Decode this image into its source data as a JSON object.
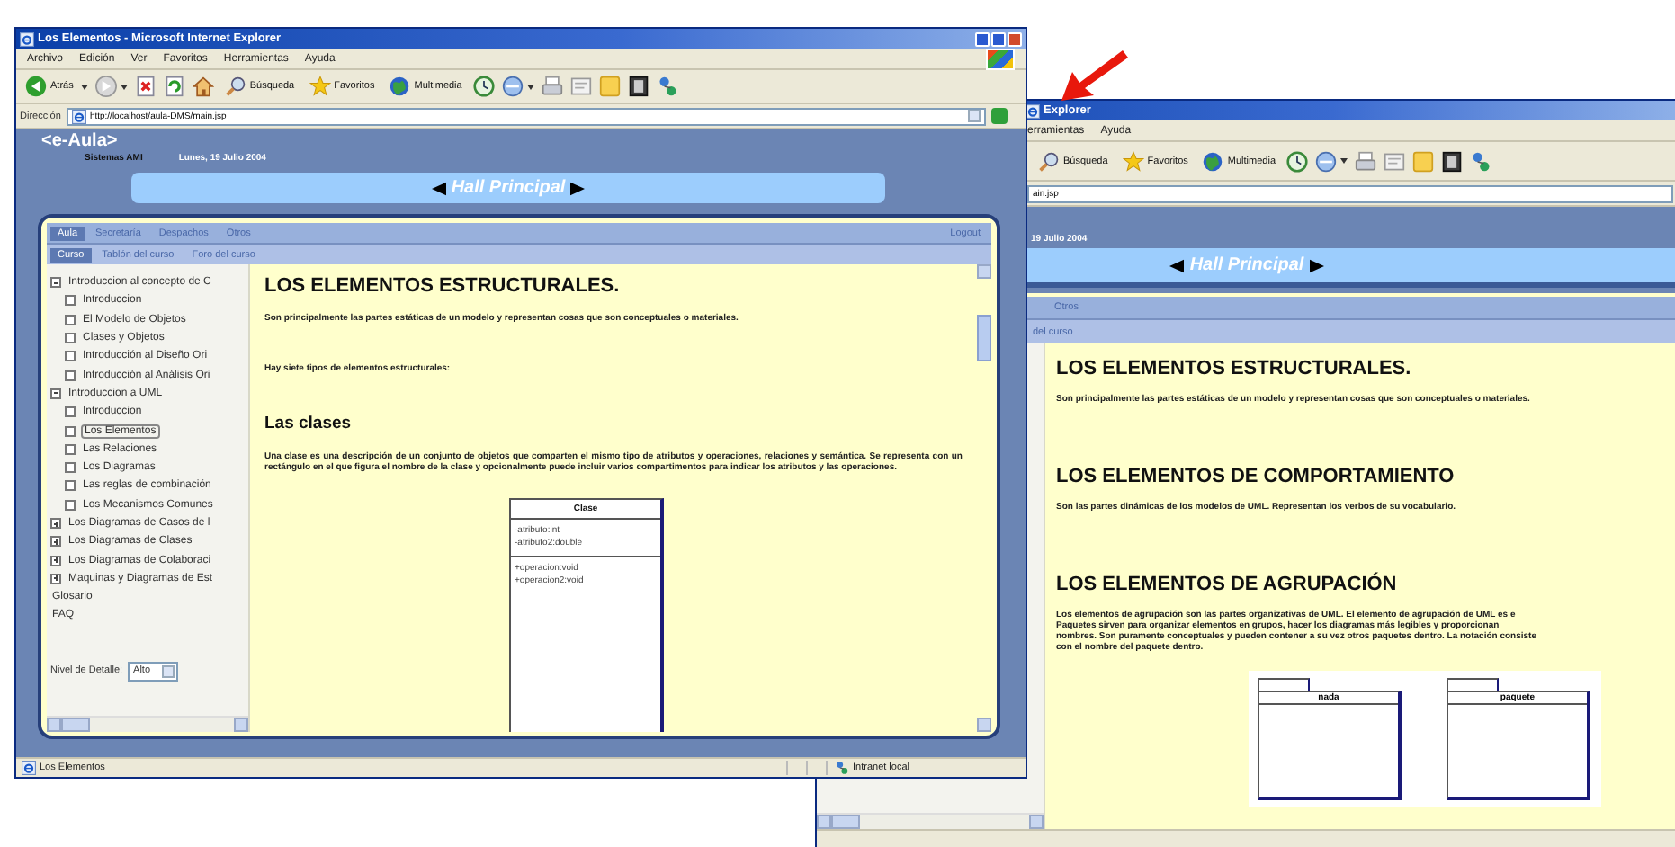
{
  "front_window": {
    "title": "Los Elementos - Microsoft Internet Explorer",
    "menu": [
      "Archivo",
      "Edición",
      "Ver",
      "Favoritos",
      "Herramientas",
      "Ayuda"
    ],
    "toolbar": [
      {
        "kind": "back",
        "label": "Atrás",
        "dropdown": true
      },
      {
        "kind": "forward",
        "dropdown": true
      },
      {
        "kind": "stop",
        "dropdown": false
      },
      {
        "kind": "refresh",
        "dropdown": false
      },
      {
        "kind": "home",
        "dropdown": false
      },
      {
        "kind": "search",
        "label": "Búsqueda",
        "dropdown": false
      },
      {
        "kind": "favorites",
        "label": "Favoritos",
        "dropdown": false
      },
      {
        "kind": "media",
        "label": "Multimedia",
        "dropdown": false
      },
      {
        "kind": "history",
        "dropdown": false
      },
      {
        "kind": "mail",
        "dropdown": true
      },
      {
        "kind": "print",
        "dropdown": false
      },
      {
        "kind": "edit",
        "dropdown": false
      },
      {
        "kind": "note",
        "dropdown": false
      },
      {
        "kind": "book",
        "dropdown": false
      },
      {
        "kind": "network",
        "dropdown": false
      }
    ],
    "address": {
      "label": "Dirección",
      "url": "http://localhost/aula-DMS/main.jsp"
    },
    "page": {
      "logo": "<e-Aula>",
      "subtitle": "Sistemas AMI",
      "date": "Lunes, 19 Julio 2004",
      "banner": "Hall Principal",
      "tabs": [
        {
          "label": "Aula",
          "selected": true
        },
        {
          "label": "Secretaría",
          "selected": false
        },
        {
          "label": "Despachos",
          "selected": false
        },
        {
          "label": "Otros",
          "selected": false
        }
      ],
      "logout": "Logout",
      "subtabs": [
        {
          "label": "Curso",
          "selected": true
        },
        {
          "label": "Tablón del curso",
          "selected": false
        },
        {
          "label": "Foro del curso",
          "selected": false
        }
      ],
      "tree": [
        {
          "kind": "group",
          "label": "Introduccion al concepto de C",
          "expanded": true,
          "selected": false,
          "children": [
            {
              "kind": "page",
              "label": "Introduccion",
              "selected": false
            },
            {
              "kind": "page",
              "label": "El Modelo de Objetos",
              "selected": false
            },
            {
              "kind": "page",
              "label": "Clases y Objetos",
              "selected": false
            },
            {
              "kind": "page",
              "label": "Introducción al Diseño Ori",
              "selected": false
            },
            {
              "kind": "page",
              "label": "Introducción al Análisis Ori",
              "selected": false
            }
          ]
        },
        {
          "kind": "group",
          "label": "Introduccion a UML",
          "expanded": true,
          "selected": false,
          "children": [
            {
              "kind": "page",
              "label": "Introduccion",
              "selected": false
            },
            {
              "kind": "page",
              "label": "Los Elementos",
              "selected": true
            },
            {
              "kind": "page",
              "label": "Las Relaciones",
              "selected": false
            },
            {
              "kind": "page",
              "label": "Los Diagramas",
              "selected": false
            },
            {
              "kind": "page",
              "label": "Las reglas de combinación",
              "selected": false
            },
            {
              "kind": "page",
              "label": "Los Mecanismos Comunes",
              "selected": false
            }
          ]
        },
        {
          "kind": "group",
          "label": "Los Diagramas de Casos de l",
          "expanded": false,
          "selected": false
        },
        {
          "kind": "group",
          "label": "Los Diagramas de Clases",
          "expanded": false,
          "selected": false
        },
        {
          "kind": "group",
          "label": "Los Diagramas de Colaboraci",
          "expanded": false,
          "selected": false
        },
        {
          "kind": "group",
          "label": "Maquinas y Diagramas de Est",
          "expanded": false,
          "selected": false
        },
        {
          "kind": "link",
          "label": "Glosario",
          "selected": false
        },
        {
          "kind": "link",
          "label": "FAQ",
          "selected": false
        }
      ],
      "detail": {
        "label": "Nivel de Detalle:",
        "value": "Alto"
      },
      "article": [
        {
          "kind": "heading",
          "text": "LOS ELEMENTOS ESTRUCTURALES."
        },
        {
          "kind": "paragraph",
          "text": "Son principalmente las partes estáticas de un modelo y representan cosas que son conceptuales o materiales."
        },
        {
          "kind": "paragraph",
          "text": "Hay siete tipos de elementos estructurales:"
        },
        {
          "kind": "subheading",
          "text": "Las clases"
        },
        {
          "kind": "paragraph",
          "text": "Una clase es una descripción de un conjunto de objetos que comparten el mismo tipo de atributos y operaciones, relaciones y semántica. Se representa con un rectángulo en el que figura el nombre de la clase y opcionalmente puede incluir varios compartimentos para indicar los atributos y las operaciones."
        },
        {
          "kind": "class_diagram",
          "name": "Clase",
          "attributes": [
            "-atributo:int",
            "-atributo2:double"
          ],
          "operations": [
            "+operacion:void",
            "+operacion2:void"
          ]
        }
      ]
    },
    "status": {
      "text": "Los Elementos",
      "zone": "Intranet local"
    }
  },
  "back_window": {
    "title": "Explorer",
    "menu": [
      "erramientas",
      "Ayuda"
    ],
    "toolbar": [
      {
        "kind": "search",
        "label": "Búsqueda",
        "dropdown": false
      },
      {
        "kind": "favorites",
        "label": "Favoritos",
        "dropdown": false
      },
      {
        "kind": "media",
        "label": "Multimedia",
        "dropdown": false
      },
      {
        "kind": "history",
        "dropdown": false
      },
      {
        "kind": "mail",
        "dropdown": true
      },
      {
        "kind": "print",
        "dropdown": false
      },
      {
        "kind": "edit",
        "dropdown": false
      },
      {
        "kind": "note",
        "dropdown": false
      },
      {
        "kind": "book",
        "dropdown": false
      },
      {
        "kind": "network",
        "dropdown": false
      }
    ],
    "address": {
      "url": "ain.jsp"
    },
    "page": {
      "date": "19 Julio 2004",
      "banner": "Hall Principal",
      "tabs": [
        {
          "label": "Otros",
          "selected": false
        }
      ],
      "subtabs": [
        {
          "label": "del curso",
          "selected": false
        }
      ],
      "article": [
        {
          "kind": "heading",
          "text": "LOS ELEMENTOS ESTRUCTURALES."
        },
        {
          "kind": "paragraph",
          "text": "Son principalmente las partes estáticas de un modelo y representan cosas que son conceptuales o materiales."
        },
        {
          "kind": "heading",
          "text": "LOS ELEMENTOS DE COMPORTAMIENTO"
        },
        {
          "kind": "paragraph",
          "text": "Son las partes dinámicas de los modelos de UML. Representan los verbos de su vocabulario."
        },
        {
          "kind": "heading",
          "text": "LOS ELEMENTOS DE AGRUPACIÓN"
        },
        {
          "kind": "lines",
          "lines": [
            "Los elementos de agrupación son las partes organizativas de UML. El elemento de agrupación de UML es e",
            "Paquetes sirven para organizar elementos en grupos, hacer los diagramas más legibles y proporcionan",
            "nombres. Son puramente conceptuales y pueden contener a su vez otros paquetes dentro. La notación consiste",
            "con el nombre del paquete dentro."
          ]
        },
        {
          "kind": "package_diagram",
          "names": [
            "nada",
            "paquete"
          ]
        }
      ]
    }
  }
}
